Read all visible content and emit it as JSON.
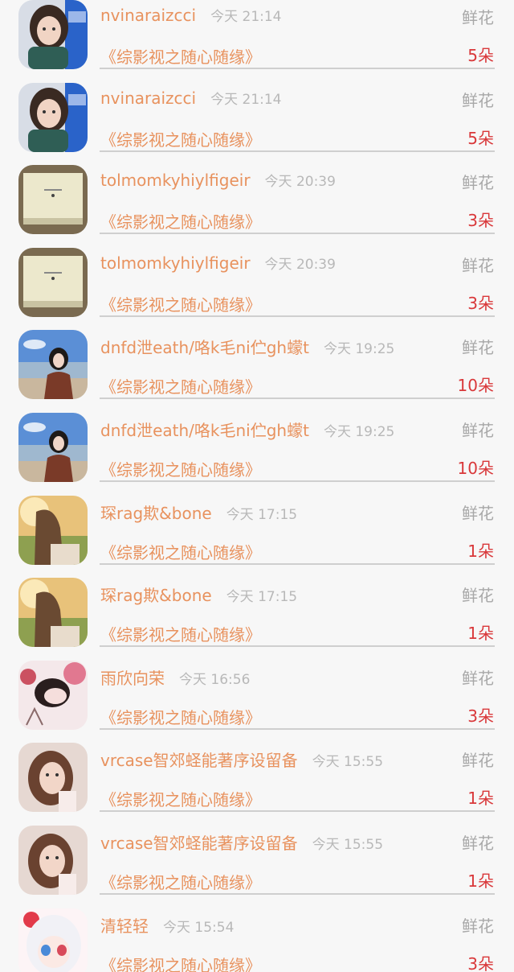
{
  "rows": [
    {
      "name": "nvinaraizcci",
      "time": "今天 21:14",
      "gift": "鲜花",
      "book": "《综影视之随心随缘》",
      "count": "5朵",
      "avatar": "girl-scarf"
    },
    {
      "name": "nvinaraizcci",
      "time": "今天 21:14",
      "gift": "鲜花",
      "book": "《综影视之随心随缘》",
      "count": "5朵",
      "avatar": "girl-scarf"
    },
    {
      "name": "tolmomkyhiylfigeir",
      "time": "今天 20:39",
      "gift": "鲜花",
      "book": "《综影视之随心随缘》",
      "count": "3朵",
      "avatar": "book-cover"
    },
    {
      "name": "tolmomkyhiylfigeir",
      "time": "今天 20:39",
      "gift": "鲜花",
      "book": "《综影视之随心随缘》",
      "count": "3朵",
      "avatar": "book-cover"
    },
    {
      "name": "dnfd泄eath/咯k毛ni伫gh蠓t",
      "time": "今天 19:25",
      "gift": "鲜花",
      "book": "《综影视之随心随缘》",
      "count": "10朵",
      "avatar": "beach-girl"
    },
    {
      "name": "dnfd泄eath/咯k毛ni伫gh蠓t",
      "time": "今天 19:25",
      "gift": "鲜花",
      "book": "《综影视之随心随缘》",
      "count": "10朵",
      "avatar": "beach-girl"
    },
    {
      "name": "琛rag欺&bone",
      "time": "今天 17:15",
      "gift": "鲜花",
      "book": "《综影视之随心随缘》",
      "count": "1朵",
      "avatar": "sunset-girl"
    },
    {
      "name": "琛rag欺&bone",
      "time": "今天 17:15",
      "gift": "鲜花",
      "book": "《综影视之随心随缘》",
      "count": "1朵",
      "avatar": "sunset-girl"
    },
    {
      "name": "雨欣向荣",
      "time": "今天 16:56",
      "gift": "鲜花",
      "book": "《综影视之随心随缘》",
      "count": "3朵",
      "avatar": "flower-girl"
    },
    {
      "name": "vrcase智郊蛏能著序设留备",
      "time": "今天 15:55",
      "gift": "鲜花",
      "book": "《综影视之随心随缘》",
      "count": "1朵",
      "avatar": "selfie-girl"
    },
    {
      "name": "vrcase智郊蛏能著序设留备",
      "time": "今天 15:55",
      "gift": "鲜花",
      "book": "《综影视之随心随缘》",
      "count": "1朵",
      "avatar": "selfie-girl"
    },
    {
      "name": "清轻轻",
      "time": "今天 15:54",
      "gift": "鲜花",
      "book": "《综影视之随心随缘》",
      "count": "3朵",
      "avatar": "anime-girl"
    }
  ]
}
